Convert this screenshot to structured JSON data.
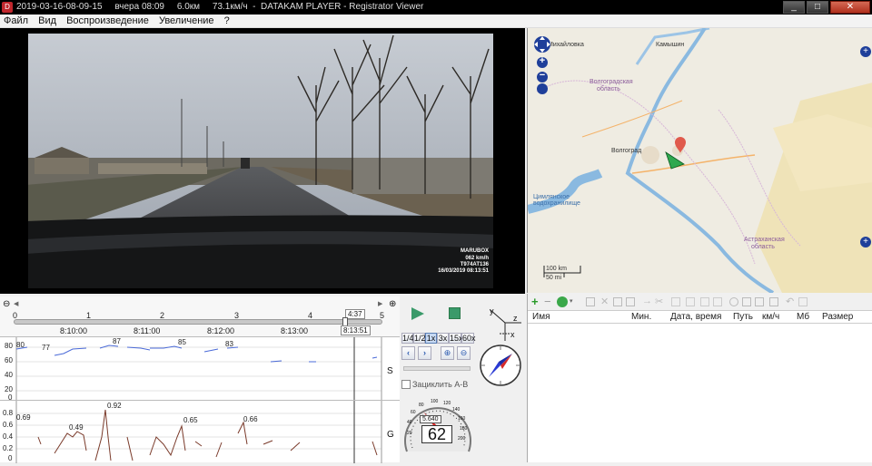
{
  "window": {
    "title": "2019-03-16-08-09-15     вчера 08:09     6.0км     73.1км/ч  -  DATAKAM PLAYER - Registrator Viewer",
    "min": "_",
    "max": "□",
    "close": "✕"
  },
  "menu": [
    "Файл",
    "Вид",
    "Воспроизведение",
    "Увеличение",
    "?"
  ],
  "video_osd": {
    "brand": "MARUBOX",
    "speed": "062 km/h",
    "plate": "T974AT136",
    "datetime": "16/03/2019 08:13:51"
  },
  "map": {
    "labels": {
      "city1": "Михайловка",
      "city2": "Камышин",
      "region1": "Волгоградская",
      "region1b": "область",
      "city3": "Волгоград",
      "reservoir": "Цимлянское",
      "reservoir_b": "водохранилище",
      "region2": "Астраханская",
      "region2b": "область"
    },
    "scale_km": "100 km",
    "scale_mi": "50 mi",
    "zoom_in": "+",
    "zoom_out": "−"
  },
  "timeline": {
    "ticks": [
      "0",
      "1",
      "2",
      "3",
      "4",
      "5"
    ],
    "position_minutes": "4:37",
    "times": [
      "8:10:00",
      "8:11:00",
      "8:12:00",
      "8:13:00"
    ],
    "current_time": "8:13:51",
    "cursor_fraction": 0.9
  },
  "speed_graph": {
    "yticks": [
      "80",
      "60",
      "40",
      "20",
      "0"
    ],
    "labels": [
      "80",
      "77",
      "87",
      "85",
      "83"
    ],
    "side_label": "S"
  },
  "g_graph": {
    "yticks": [
      "0.8",
      "0.6",
      "0.4",
      "0.2",
      "0"
    ],
    "labels": [
      "0.69",
      "0.49",
      "0.92",
      "0.65",
      "0.66"
    ],
    "side_label": "G"
  },
  "playback": {
    "speeds": [
      "1/4",
      "1/2",
      "1x",
      "3x",
      "15x",
      "60x"
    ],
    "active_speed": "1x",
    "loop_label": "Зациклить А-В",
    "axes": {
      "x": "x",
      "y": "y",
      "z": "z"
    }
  },
  "speedometer": {
    "value": "62",
    "odometer": "5.640",
    "scale": [
      "20",
      "40",
      "60",
      "80",
      "100",
      "120",
      "140",
      "160",
      "180",
      "200"
    ]
  },
  "file_list": {
    "columns": [
      "Имя",
      "Мин.",
      "Дата, время",
      "Путь",
      "км/ч",
      "Мб",
      "Размер"
    ]
  }
}
